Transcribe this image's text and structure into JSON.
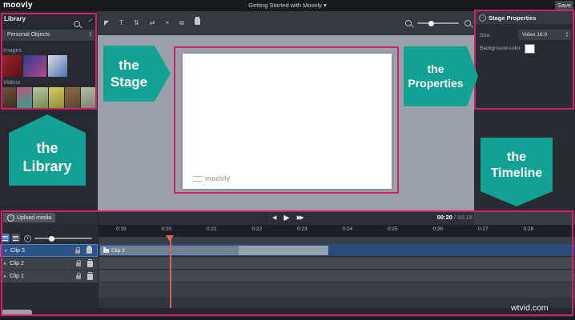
{
  "app": {
    "logo": "moovly",
    "title": "Getting Started with Moovly",
    "caret": "▾",
    "save": "Save"
  },
  "colors": {
    "accent_teal": "#12a192",
    "outline_pink": "#d2216a",
    "playhead": "#e4645c",
    "selection_blue": "#2e5388",
    "swatch": "#ffffff"
  },
  "library": {
    "title": "Library",
    "category": "Personal Objects",
    "images_label": "Images",
    "videos_label": "Videos",
    "image_thumbs": [
      {
        "name": "red-graphic",
        "colors": [
          "#9c2227",
          "#5e1215"
        ]
      },
      {
        "name": "blue-pink-graphic",
        "colors": [
          "#2a3a8e",
          "#b34b8a"
        ]
      },
      {
        "name": "boy-portrait",
        "colors": [
          "#dcdee2",
          "#4a72b8"
        ]
      }
    ],
    "video_thumbs": [
      {
        "name": "horse-path",
        "colors": [
          "#6d523c",
          "#3f2e22"
        ]
      },
      {
        "name": "person-pink-teal",
        "colors": [
          "#c2557e",
          "#2ea390"
        ]
      },
      {
        "name": "green-field",
        "colors": [
          "#b8c4a8",
          "#6f8f4a"
        ]
      },
      {
        "name": "autumn-trees",
        "colors": [
          "#d8c95e",
          "#8f8f3a"
        ]
      },
      {
        "name": "barn",
        "colors": [
          "#8a6a4a",
          "#5d4430"
        ]
      },
      {
        "name": "country-road",
        "colors": [
          "#b5bfa5",
          "#78806a"
        ]
      }
    ]
  },
  "toolbar": {
    "icons": [
      {
        "name": "select-tool",
        "glyph": "◤"
      },
      {
        "name": "text-tool",
        "glyph": "T"
      },
      {
        "name": "arrange-vertical-tool",
        "glyph": "⇅"
      },
      {
        "name": "arrange-horizontal-tool",
        "glyph": "⇄"
      },
      {
        "name": "cut-tool",
        "glyph": "×"
      },
      {
        "name": "copy-tool",
        "glyph": "⧉"
      },
      {
        "name": "delete-tool",
        "css": "trash"
      }
    ]
  },
  "stage": {
    "watermark": "moovly"
  },
  "properties": {
    "title": "Stage Properties",
    "size_label": "Size",
    "size_value": "Video 16:9",
    "bg_label": "Background-color"
  },
  "icons": {
    "back": "◀",
    "play": "▶",
    "forward": "▶▶",
    "track_arrow": "▸"
  },
  "timeline": {
    "upload_label": "Upload media",
    "time_current": "00:20",
    "time_separator": "/",
    "time_total": "00:18",
    "ruler": [
      "0:19",
      "0:20",
      "0:21",
      "0:22",
      "0:23",
      "0:24",
      "0:25",
      "0:26",
      "0:27",
      "0:28"
    ],
    "tracks": [
      {
        "label": "Clip 3",
        "selected": true,
        "clip": {
          "label": "Clip 3"
        }
      },
      {
        "label": "Clip 2",
        "selected": false
      },
      {
        "label": "Clip 1",
        "selected": false
      }
    ]
  },
  "badges": [
    {
      "id": "stage",
      "lines": [
        "the",
        "Stage"
      ]
    },
    {
      "id": "properties",
      "lines": [
        "the",
        "Properties"
      ]
    },
    {
      "id": "library",
      "lines": [
        "the",
        "Library"
      ]
    },
    {
      "id": "timeline",
      "lines": [
        "the",
        "Timeline"
      ]
    }
  ],
  "watermark": {
    "site": "wtvid.com"
  }
}
